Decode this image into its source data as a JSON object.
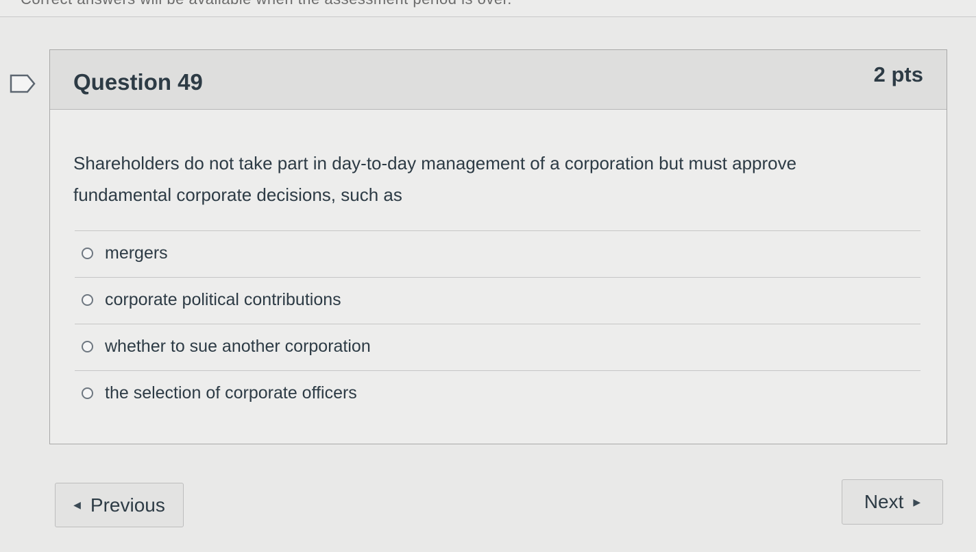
{
  "top_strip": {
    "cut_text": "Correct answers will be available when the assessment period is over."
  },
  "question": {
    "title": "Question 49",
    "points": "2 pts",
    "text": "Shareholders do not take part in day-to-day management of a corporation but must approve fundamental corporate decisions, such as",
    "answers": [
      {
        "label": "mergers",
        "selected": false
      },
      {
        "label": "corporate political contributions",
        "selected": false
      },
      {
        "label": "whether to sue another corporation",
        "selected": false
      },
      {
        "label": "the selection of corporate officers",
        "selected": false
      }
    ]
  },
  "navigation": {
    "previous_label": "Previous",
    "next_label": "Next",
    "previous_icon": "caret-left-icon",
    "next_icon": "caret-right-icon"
  },
  "icons": {
    "flag": "flag-bookmark-icon"
  },
  "colors": {
    "background": "#e9e9e8",
    "header": "#dededd",
    "text": "#2d3b45"
  }
}
